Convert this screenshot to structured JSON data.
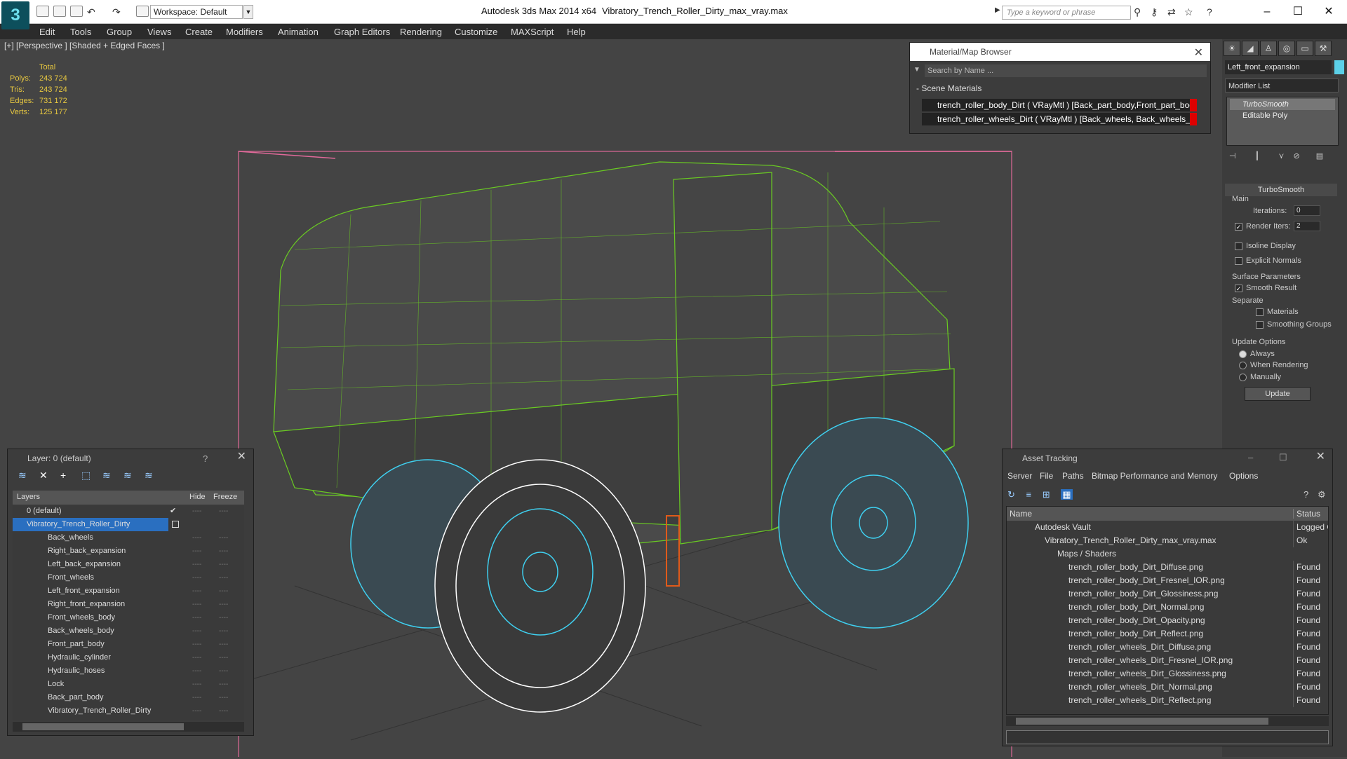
{
  "titlebar": {
    "workspace": "Workspace: Default",
    "app_title": "Autodesk 3ds Max  2014 x64",
    "file_title": "Vibratory_Trench_Roller_Dirty_max_vray.max",
    "search_placeholder": "Type a keyword or phrase"
  },
  "menu": [
    "Edit",
    "Tools",
    "Group",
    "Views",
    "Create",
    "Modifiers",
    "Animation",
    "Graph Editors",
    "Rendering",
    "Customize",
    "MAXScript",
    "Help"
  ],
  "viewport": {
    "label": "[+] [Perspective ] [Shaded + Edged Faces ]",
    "stats_header": "Total",
    "stats": [
      {
        "label": "Polys:",
        "value": "243 724"
      },
      {
        "label": "Tris:",
        "value": "243 724"
      },
      {
        "label": "Edges:",
        "value": "731 172"
      },
      {
        "label": "Verts:",
        "value": "125 177"
      }
    ]
  },
  "material_browser": {
    "title": "Material/Map Browser",
    "search": "Search by Name ...",
    "section": "- Scene Materials",
    "items": [
      "trench_roller_body_Dirt ( VRayMtl ) [Back_part_body,Front_part_body...",
      "trench_roller_wheels_Dirt ( VRayMtl ) [Back_wheels, Back_wheels_bo..."
    ]
  },
  "command_panel": {
    "object_name": "Left_front_expansion",
    "object_color": "#5cd0e8",
    "modifier_list": "Modifier List",
    "stack": [
      "TurboSmooth",
      "Editable Poly"
    ],
    "rollout": "TurboSmooth",
    "main": "Main",
    "iterations_label": "Iterations:",
    "iterations": "0",
    "render_iters_label": "Render Iters:",
    "render_iters": "2",
    "isoline": "Isoline Display",
    "explicit": "Explicit Normals",
    "surface_params": "Surface Parameters",
    "smooth_result": "Smooth Result",
    "separate": "Separate",
    "materials": "Materials",
    "smoothing_groups": "Smoothing Groups",
    "update_options": "Update Options",
    "always": "Always",
    "when_rendering": "When Rendering",
    "manually": "Manually",
    "update": "Update"
  },
  "layer_panel": {
    "title": "Layer: 0 (default)",
    "help": "?",
    "col_layers": "Layers",
    "col_hide": "Hide",
    "col_freeze": "Freeze",
    "layers": [
      "0 (default)",
      "Vibratory_Trench_Roller_Dirty",
      "Back_wheels",
      "Right_back_expansion",
      "Left_back_expansion",
      "Front_wheels",
      "Left_front_expansion",
      "Right_front_expansion",
      "Front_wheels_body",
      "Back_wheels_body",
      "Front_part_body",
      "Hydraulic_cylinder",
      "Hydraulic_hoses",
      "Lock",
      "Back_part_body",
      "Vibratory_Trench_Roller_Dirty"
    ],
    "dash": "----"
  },
  "asset_tracking": {
    "title": "Asset Tracking",
    "menu": [
      "Server",
      "File",
      "Paths",
      "Bitmap Performance and Memory",
      "Options"
    ],
    "col_name": "Name",
    "col_status": "Status",
    "rows": [
      {
        "name": "Autodesk Vault",
        "status": "Logged O",
        "indent": 1
      },
      {
        "name": "Vibratory_Trench_Roller_Dirty_max_vray.max",
        "status": "Ok",
        "indent": 2
      },
      {
        "name": "Maps / Shaders",
        "status": "",
        "indent": 3
      },
      {
        "name": "trench_roller_body_Dirt_Diffuse.png",
        "status": "Found",
        "indent": 4
      },
      {
        "name": "trench_roller_body_Dirt_Fresnel_IOR.png",
        "status": "Found",
        "indent": 4
      },
      {
        "name": "trench_roller_body_Dirt_Glossiness.png",
        "status": "Found",
        "indent": 4
      },
      {
        "name": "trench_roller_body_Dirt_Normal.png",
        "status": "Found",
        "indent": 4
      },
      {
        "name": "trench_roller_body_Dirt_Opacity.png",
        "status": "Found",
        "indent": 4
      },
      {
        "name": "trench_roller_body_Dirt_Reflect.png",
        "status": "Found",
        "indent": 4
      },
      {
        "name": "trench_roller_wheels_Dirt_Diffuse.png",
        "status": "Found",
        "indent": 4
      },
      {
        "name": "trench_roller_wheels_Dirt_Fresnel_IOR.png",
        "status": "Found",
        "indent": 4
      },
      {
        "name": "trench_roller_wheels_Dirt_Glossiness.png",
        "status": "Found",
        "indent": 4
      },
      {
        "name": "trench_roller_wheels_Dirt_Normal.png",
        "status": "Found",
        "indent": 4
      },
      {
        "name": "trench_roller_wheels_Dirt_Reflect.png",
        "status": "Found",
        "indent": 4
      }
    ]
  }
}
